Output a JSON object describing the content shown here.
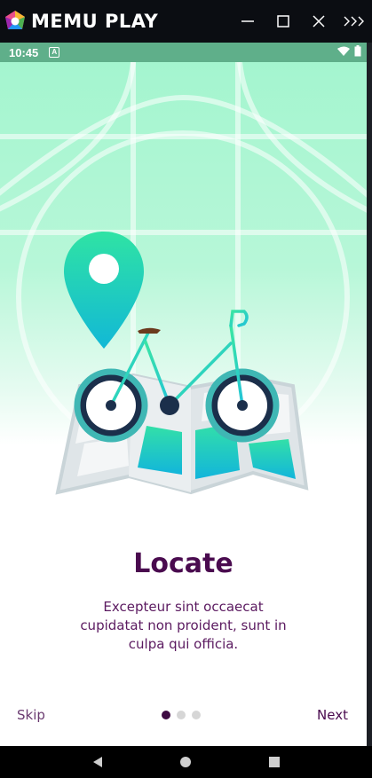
{
  "emulator": {
    "title": "MEMU PLAY",
    "controls": [
      "minimize-icon",
      "maximize-icon",
      "close-icon",
      "more-icon"
    ]
  },
  "status_bar": {
    "time": "10:45",
    "notification_icon": "A",
    "icons": [
      "wifi-icon",
      "battery-icon"
    ]
  },
  "onboarding": {
    "title": "Locate",
    "description": "Excepteur sint occaecat cupidatat non proident, sunt in culpa qui officia.",
    "skip_label": "Skip",
    "next_label": "Next",
    "page_count": 3,
    "current_page": 1
  },
  "nav_bar": {
    "buttons": [
      "back-icon",
      "home-icon",
      "recents-icon"
    ]
  },
  "colors": {
    "title": "#4a0b4f",
    "accent_gradient_top": "#2fe3a4",
    "accent_gradient_bottom": "#12b8d6",
    "dot_active": "#3d0a42",
    "dot_inactive": "#d6d6d6"
  }
}
